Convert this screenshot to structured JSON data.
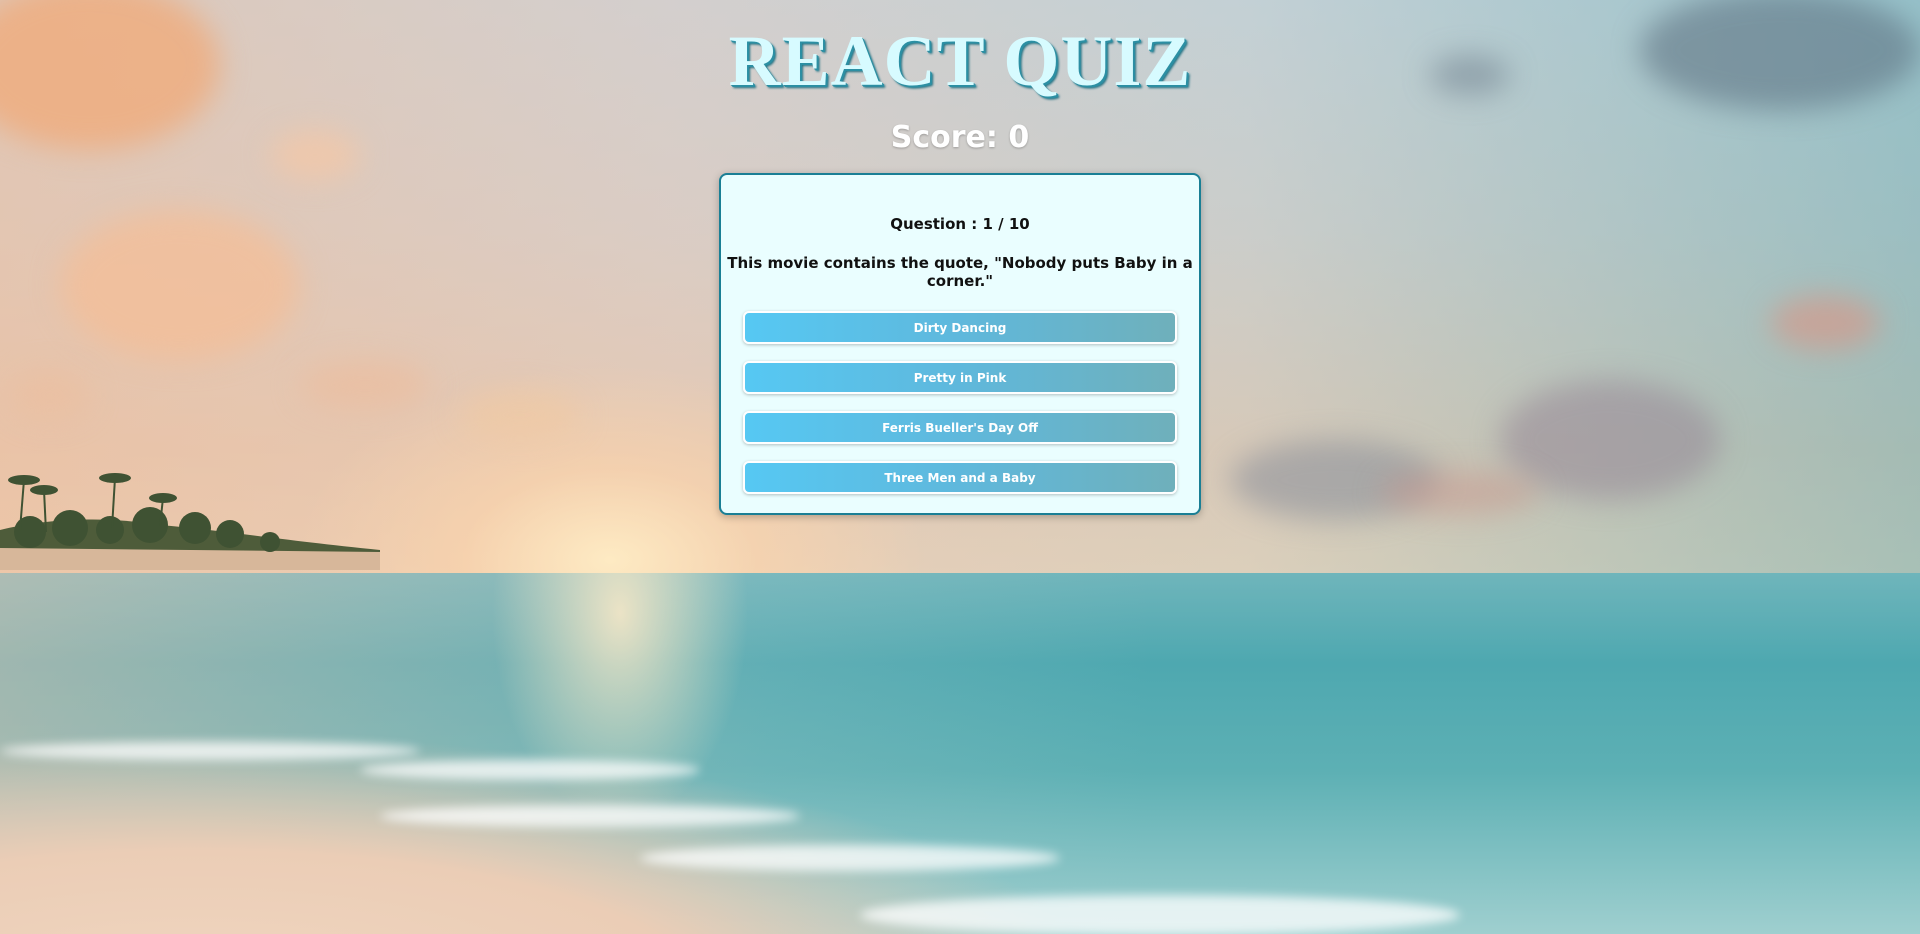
{
  "header": {
    "title": "REACT QUIZ",
    "score": "Score: 0"
  },
  "quiz": {
    "question_number": "Question : 1 / 10",
    "question_text": "This movie contains the quote, \"Nobody puts Baby in a corner.\"",
    "answers": [
      {
        "label": "Dirty Dancing"
      },
      {
        "label": "Pretty in Pink"
      },
      {
        "label": "Ferris Bueller's Day Off"
      },
      {
        "label": "Three Men and a Baby"
      }
    ]
  },
  "colors": {
    "title": "#d7fbff",
    "card_bg": "#eafeff",
    "card_border": "#1a7f95",
    "answer_gradient_start": "#56c8f3",
    "answer_gradient_end": "#6fb0bb"
  }
}
